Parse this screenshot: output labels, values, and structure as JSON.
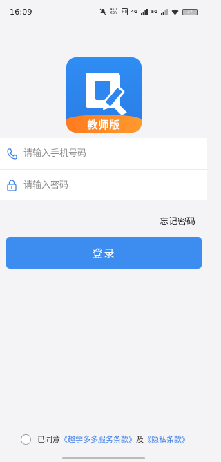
{
  "status_bar": {
    "time": "16:09",
    "net_speed_value": "45.1",
    "net_speed_unit": "KB/s",
    "signal_1": "4G",
    "signal_2": "5G",
    "battery": "37"
  },
  "logo": {
    "icon": "pencil-document-icon",
    "label": "教师版",
    "colors": {
      "primary": "#2f8df3",
      "band": "#ff8a25"
    }
  },
  "form": {
    "phone": {
      "placeholder": "请输入手机号码",
      "value": "",
      "icon": "phone-icon"
    },
    "password": {
      "placeholder": "请输入密码",
      "value": "",
      "icon": "lock-icon"
    },
    "forgot_label": "忘记密码",
    "login_label": "登录"
  },
  "agreement": {
    "prefix": "已同意",
    "service_link": "《趣学多多服务条款》",
    "joiner": "及",
    "privacy_link": "《隐私条款》",
    "checked": false
  },
  "colors": {
    "accent": "#3d8cf0",
    "link": "#3d7fe8",
    "background": "#f4f4f6"
  }
}
